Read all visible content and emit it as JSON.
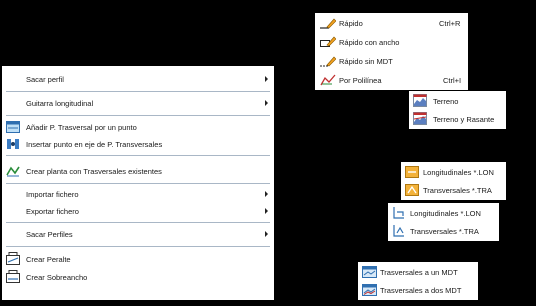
{
  "main_menu": {
    "items": [
      {
        "label": "Sacar perfil",
        "icon": null,
        "submenu": true
      },
      {
        "label": "Guitarra longitudinal",
        "icon": null,
        "submenu": true
      },
      {
        "label": "Añadir P. Trasversal por un punto",
        "icon": "add-cross-section-icon",
        "submenu": false
      },
      {
        "label": "Insertar punto en eje de P. Transversales",
        "icon": "insert-point-icon",
        "submenu": false
      },
      {
        "label": "Crear planta con Trasversales existentes",
        "icon": "create-plan-icon",
        "submenu": false
      },
      {
        "label": "Importar fichero",
        "icon": null,
        "submenu": true
      },
      {
        "label": "Exportar fichero",
        "icon": null,
        "submenu": true
      },
      {
        "label": "Sacar Perfiles",
        "icon": null,
        "submenu": true
      },
      {
        "label": "Crear Peralte",
        "icon": "superelevation-icon",
        "submenu": false
      },
      {
        "label": "Crear Sobreancho",
        "icon": "widening-icon",
        "submenu": false
      }
    ]
  },
  "sacar_perfil_menu": {
    "items": [
      {
        "label": "Rápido",
        "shortcut": "Ctrl+R",
        "icon": "pencil-profile-icon"
      },
      {
        "label": "Rápido con ancho",
        "shortcut": "",
        "icon": "pencil-width-icon"
      },
      {
        "label": "Rápido sin MDT",
        "shortcut": "",
        "icon": "pencil-no-dtm-icon"
      },
      {
        "label": "Por Polilínea",
        "shortcut": "Ctrl+I",
        "icon": "polyline-icon"
      }
    ]
  },
  "guitarra_menu": {
    "items": [
      {
        "label": "Terreno",
        "icon": "terrain-icon"
      },
      {
        "label": "Terreno y Rasante",
        "icon": "terrain-grade-icon"
      }
    ]
  },
  "importar_menu": {
    "items": [
      {
        "label": "Longitudinales *.LON",
        "icon": "import-lon-icon"
      },
      {
        "label": "Transversales *.TRA",
        "icon": "import-tra-icon"
      }
    ]
  },
  "exportar_menu": {
    "items": [
      {
        "label": "Longitudinales *.LON",
        "icon": "export-lon-icon"
      },
      {
        "label": "Transversales *.TRA",
        "icon": "export-tra-icon"
      }
    ]
  },
  "sacar_perfiles_menu": {
    "items": [
      {
        "label": "Trasversales a un MDT",
        "icon": "cross-one-dtm-icon"
      },
      {
        "label": "Trasversales a dos MDT",
        "icon": "cross-two-dtm-icon"
      }
    ]
  }
}
